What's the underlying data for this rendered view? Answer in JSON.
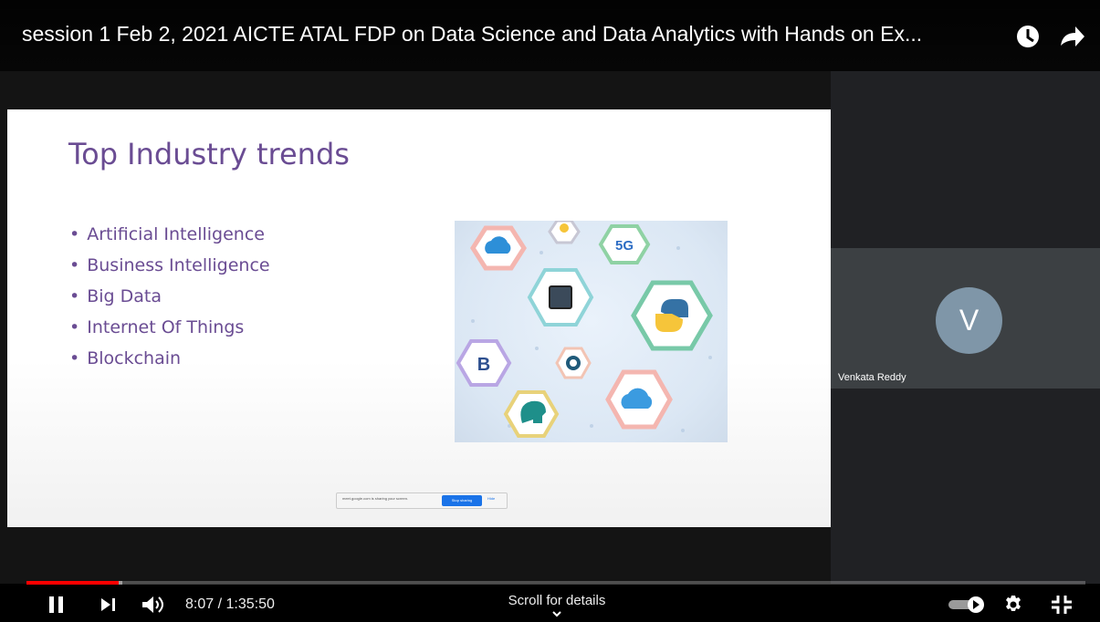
{
  "player": {
    "title": "session 1 Feb 2, 2021 AICTE ATAL FDP on Data Science and Data Analytics with Hands on Ex...",
    "current_time": "8:07",
    "time_separator": " / ",
    "duration": "1:35:50",
    "scroll_hint": "Scroll for details",
    "progress_fraction": 0.0874,
    "buffer_fraction": 0.0909,
    "icons": {
      "watch_later": "clock-icon",
      "share": "share-arrow-icon",
      "play_pause": "pause-icon",
      "next": "next-icon",
      "volume": "volume-icon",
      "autoplay": "autoplay-toggle-icon",
      "settings": "gear-icon",
      "fullscreen": "exit-fullscreen-icon",
      "scroll": "chevron-down-icon"
    },
    "colors": {
      "progress": "#ff0000",
      "background": "#000000"
    }
  },
  "slide": {
    "title": "Top Industry trends",
    "bullets": [
      "Artificial Intelligence",
      "Business Intelligence",
      "Big Data",
      "Internet Of Things",
      "Blockchain"
    ],
    "image_labels": {
      "network": "5G",
      "crypto": "B"
    },
    "title_color": "#6a4c93",
    "share_bar": {
      "message": "meet.google.com is sharing your screen.",
      "stop_label": "Stop sharing",
      "hide_label": "Hide"
    }
  },
  "meeting": {
    "participant_name": "Venkata Reddy",
    "avatar_initial": "V",
    "avatar_color": "#7f96a8"
  }
}
